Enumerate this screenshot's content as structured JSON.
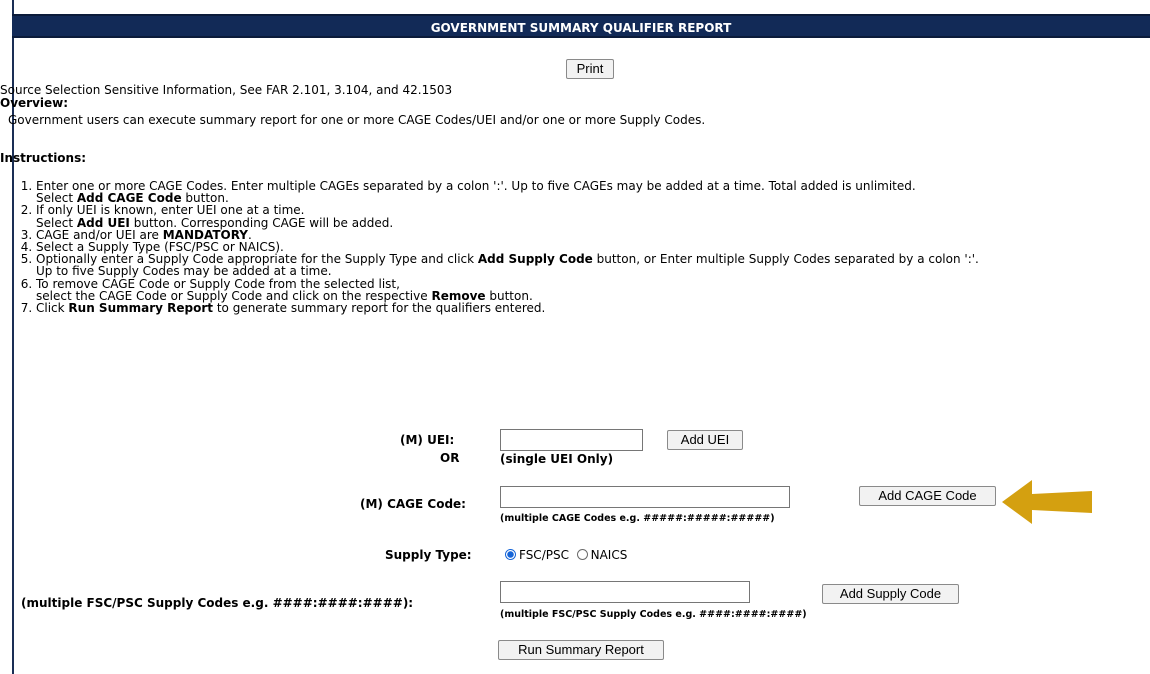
{
  "header": {
    "title": "GOVERNMENT SUMMARY QUALIFIER REPORT"
  },
  "print_label": "Print",
  "notice": "Source Selection Sensitive Information, See FAR 2.101, 3.104, and 42.1503",
  "overview": {
    "heading": "Overview:",
    "text": "Government users can execute summary report for one or more CAGE Codes/UEI and/or one or more Supply Codes."
  },
  "instructions": {
    "heading": "Instructions:",
    "items": [
      {
        "a": "Enter one or more CAGE Codes. Enter multiple CAGEs separated by a colon ':'. Up to five CAGEs may be added at a time. Total added is unlimited.",
        "b": "Select ",
        "c": "Add CAGE Code",
        "d": " button."
      },
      {
        "a": "If only UEI is known, enter UEI one at a time.",
        "b": "Select ",
        "c": "Add UEI",
        "d": " button. Corresponding CAGE will be added."
      },
      {
        "a": "CAGE and/or UEI are ",
        "c": "MANDATORY",
        "d": "."
      },
      {
        "a": "Select a Supply Type (FSC/PSC or NAICS)."
      },
      {
        "a": "Optionally enter a Supply Code appropriate for the Supply Type and click ",
        "c": "Add Supply Code",
        "d": " button, or Enter multiple Supply Codes separated by a colon ':'.",
        "b": "Up to five Supply Codes may be added at a time."
      },
      {
        "a": "To remove CAGE Code or Supply Code from the selected list,",
        "b": "select the CAGE Code or Supply Code and click on the respective ",
        "c": "Remove",
        "d": " button."
      },
      {
        "a": "Click ",
        "c": "Run Summary Report",
        "d": " to generate summary report for the qualifiers entered."
      }
    ]
  },
  "form": {
    "uei_label": "(M) UEI:",
    "or_label": "OR",
    "uei_hint": "(single UEI Only)",
    "add_uei": "Add UEI",
    "uei_value": "",
    "cage_label": "(M) CAGE Code:",
    "cage_hint": "(multiple CAGE Codes e.g. #####:#####:#####)",
    "add_cage": "Add CAGE Code",
    "cage_value": "",
    "supply_type_label": "Supply Type:",
    "supply_options": [
      "FSC/PSC",
      "NAICS"
    ],
    "supply_selected": "FSC/PSC",
    "supply_code_label": "(multiple FSC/PSC Supply Codes e.g. ####:####:####):",
    "supply_hint": "(multiple FSC/PSC Supply Codes e.g. ####:####:####)",
    "add_supply": "Add Supply Code",
    "supply_value": "",
    "run_report": "Run Summary Report"
  },
  "colors": {
    "title_bar": "#122a57",
    "arrow": "#d4a010",
    "radio_selected": "#1464d8"
  }
}
